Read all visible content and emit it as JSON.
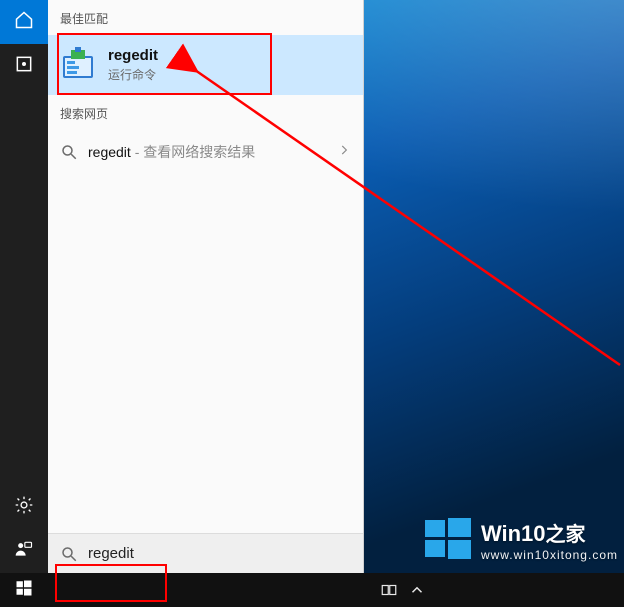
{
  "groups": {
    "best_match_header": "最佳匹配",
    "web_header": "搜索网页"
  },
  "best_match": {
    "title": "regedit",
    "subtitle": "运行命令"
  },
  "web_item": {
    "term": "regedit",
    "hint": " - 查看网络搜索结果"
  },
  "searchbox": {
    "value": "regedit",
    "placeholder": ""
  },
  "brand": {
    "line1_a": "Win10",
    "line1_b": "之家",
    "line2": "www.win10xitong.com"
  }
}
